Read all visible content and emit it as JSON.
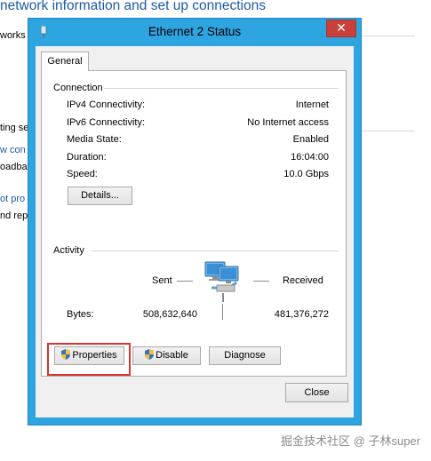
{
  "background": {
    "title": "network information and set up connections",
    "fragments": [
      "works",
      "ting se",
      "w con",
      "oadba",
      "ot pro",
      "nd rep"
    ]
  },
  "window": {
    "title": "Ethernet 2 Status",
    "close_label": "✕",
    "tab_label": "General"
  },
  "connection": {
    "group_label": "Connection",
    "rows": [
      {
        "label": "IPv4 Connectivity:",
        "value": "Internet"
      },
      {
        "label": "IPv6 Connectivity:",
        "value": "No Internet access"
      },
      {
        "label": "Media State:",
        "value": "Enabled"
      },
      {
        "label": "Duration:",
        "value": "16:04:00"
      },
      {
        "label": "Speed:",
        "value": "10.0 Gbps"
      }
    ],
    "details_label": "Details..."
  },
  "activity": {
    "group_label": "Activity",
    "sent_label": "Sent",
    "received_label": "Received",
    "bytes_label": "Bytes:",
    "bytes_sent": "508,632,640",
    "bytes_received": "481,376,272"
  },
  "buttons": {
    "properties": "Properties",
    "disable": "Disable",
    "diagnose": "Diagnose",
    "close": "Close"
  },
  "watermark": "掘金技术社区 @ 子林super",
  "colors": {
    "frame": "#2ea4e0",
    "close_button": "#c9403a",
    "highlight": "#d9352e",
    "link": "#1e5aa8"
  }
}
